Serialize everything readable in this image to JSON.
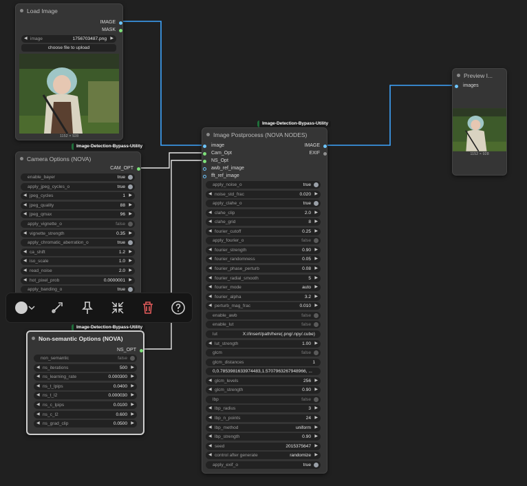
{
  "colors": {
    "canvas": "#202020",
    "node": "#353535",
    "widget": "#222222",
    "wire_image": "#3ea6ff",
    "wire_other": "#e8e8e8",
    "badge_accent": "#1f6f3a",
    "delete": "#e35b5b"
  },
  "load_image": {
    "title": "Load Image",
    "outputs": [
      "IMAGE",
      "MASK"
    ],
    "image_label": "image",
    "image_value": "1756703487.png",
    "upload_button": "choose file to upload",
    "size": "1152 × 928"
  },
  "preview": {
    "title": "Preview I...",
    "input": "images",
    "size": "1152 × 928"
  },
  "camera": {
    "badge": "Image-Detection-Bypass-Utility",
    "title": "Camera Options (NOVA)",
    "output": "CAM_OPT",
    "widgets": [
      {
        "label": "enable_bayer",
        "value": "true"
      },
      {
        "label": "apply_jpeg_cycles_o",
        "value": "true"
      },
      {
        "label": "jpeg_cycles",
        "value": "1"
      },
      {
        "label": "jpeg_quality",
        "value": "88"
      },
      {
        "label": "jpeg_qmax",
        "value": "96"
      },
      {
        "label": "apply_vignette_o",
        "value": "false"
      },
      {
        "label": "vignette_strength",
        "value": "0.35"
      },
      {
        "label": "apply_chromatic_aberration_o",
        "value": "true"
      },
      {
        "label": "ca_shift",
        "value": "1.2"
      },
      {
        "label": "iso_scale",
        "value": "1.0"
      },
      {
        "label": "read_noise",
        "value": "2.0"
      },
      {
        "label": "hot_pixel_prob",
        "value": "0.0000001"
      },
      {
        "label": "apply_banding_o",
        "value": "true"
      }
    ]
  },
  "toolbar": {
    "icons": [
      "color-circle-icon",
      "chevron-down-icon",
      "bypass-wand-icon",
      "pin-icon",
      "collapse-icon",
      "trash-icon",
      "help-icon"
    ]
  },
  "nonsem": {
    "badge": "Image-Detection-Bypass-Utility",
    "title": "Non-semantic Options (NOVA)",
    "output": "NS_OPT",
    "widgets": [
      {
        "label": "non_semantic",
        "value": "false"
      },
      {
        "label": "ns_iterations",
        "value": "500"
      },
      {
        "label": "ns_learning_rate",
        "value": "0.000300"
      },
      {
        "label": "ns_t_lpips",
        "value": "0.0400"
      },
      {
        "label": "ns_t_l2",
        "value": "0.000030"
      },
      {
        "label": "ns_c_lpips",
        "value": "0.0100"
      },
      {
        "label": "ns_c_l2",
        "value": "0.600"
      },
      {
        "label": "ns_grad_clip",
        "value": "0.0500"
      }
    ]
  },
  "post": {
    "badge": "Image-Detection-Bypass-Utility",
    "title": "Image Postprocess (NOVA NODES)",
    "inputs": [
      "image",
      "Cam_Opt",
      "NS_Opt",
      "awb_ref_image",
      "fft_ref_image"
    ],
    "outputs": [
      "IMAGE",
      "EXIF"
    ],
    "widgets": [
      {
        "label": "apply_noise_o",
        "value": "true"
      },
      {
        "label": "noise_std_frac",
        "value": "0.020"
      },
      {
        "label": "apply_clahe_o",
        "value": "true"
      },
      {
        "label": "clahe_clip",
        "value": "2.0"
      },
      {
        "label": "clahe_grid",
        "value": "8"
      },
      {
        "label": "fourier_cutoff",
        "value": "0.25"
      },
      {
        "label": "apply_fourier_o",
        "value": "false"
      },
      {
        "label": "fourier_strength",
        "value": "0.90"
      },
      {
        "label": "fourier_randomness",
        "value": "0.05"
      },
      {
        "label": "fourier_phase_perturb",
        "value": "0.08"
      },
      {
        "label": "fourier_radial_smooth",
        "value": "5"
      },
      {
        "label": "fourier_mode",
        "value": "auto"
      },
      {
        "label": "fourier_alpha",
        "value": "3.2"
      },
      {
        "label": "perturb_mag_frac",
        "value": "0.010"
      },
      {
        "label": "enable_awb",
        "value": "false"
      },
      {
        "label": "enable_lut",
        "value": "false"
      },
      {
        "label": "lut",
        "value": "X://insert/path/here(.png/.npy/.cube)"
      },
      {
        "label": "lut_strength",
        "value": "1.00"
      },
      {
        "label": "glcm",
        "value": "false"
      },
      {
        "label": "glcm_distances",
        "value": "1"
      },
      {
        "label": "",
        "value": "0,0.7853981633974483,1.5707963267948966, ..."
      },
      {
        "label": "glcm_levels",
        "value": "256"
      },
      {
        "label": "glcm_strength",
        "value": "0.90"
      },
      {
        "label": "lbp",
        "value": "false"
      },
      {
        "label": "lbp_radius",
        "value": "3"
      },
      {
        "label": "lbp_n_points",
        "value": "24"
      },
      {
        "label": "lbp_method",
        "value": "uniform"
      },
      {
        "label": "lbp_strength",
        "value": "0.90"
      },
      {
        "label": "seed",
        "value": "2015375647"
      },
      {
        "label": "control after generate",
        "value": "randomize"
      },
      {
        "label": "apply_exif_o",
        "value": "true"
      }
    ]
  }
}
